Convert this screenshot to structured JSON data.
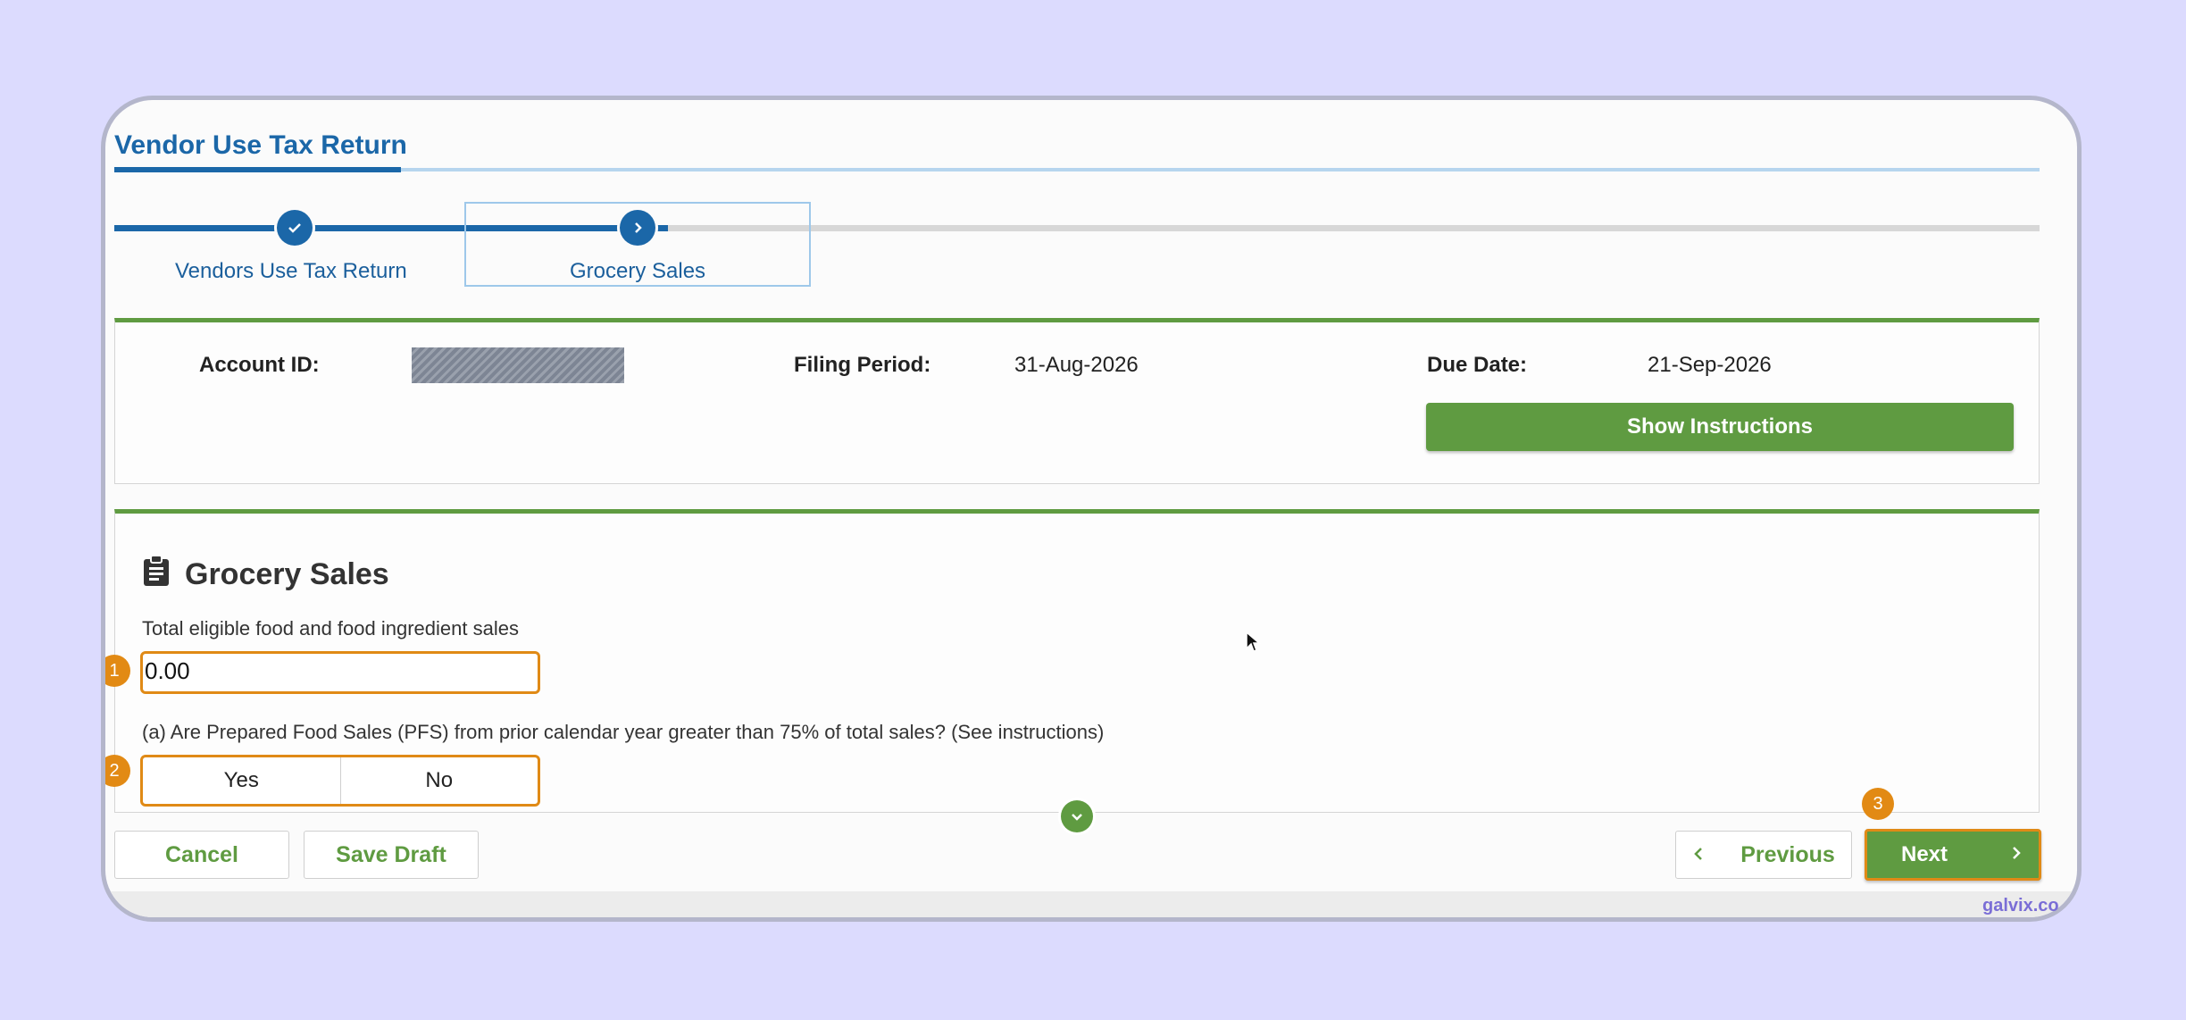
{
  "header": {
    "title": "Vendor Use Tax Return"
  },
  "stepper": {
    "steps": [
      {
        "label": "Vendors Use Tax Return",
        "state": "completed",
        "icon": "check-icon"
      },
      {
        "label": "Grocery Sales",
        "state": "current",
        "icon": "chevron-right-icon"
      }
    ]
  },
  "info": {
    "account_id_label": "Account ID:",
    "filing_period_label": "Filing Period:",
    "filing_period_value": "31-Aug-2026",
    "due_date_label": "Due Date:",
    "due_date_value": "21-Sep-2026",
    "show_instructions_label": "Show Instructions"
  },
  "form": {
    "section_title": "Grocery Sales",
    "section_icon": "clipboard-icon",
    "food_sales_label": "Total eligible food and food ingredient sales",
    "food_sales_value": "0.00",
    "pfs_question": "(a) Are Prepared Food Sales (PFS) from prior calendar year greater than 75% of total sales? (See instructions)",
    "yes_label": "Yes",
    "no_label": "No"
  },
  "annotations": {
    "badge1": "1",
    "badge2": "2",
    "badge3": "3"
  },
  "footer": {
    "cancel_label": "Cancel",
    "save_draft_label": "Save Draft",
    "previous_label": "Previous",
    "next_label": "Next"
  },
  "watermark": "galvix.co",
  "colors": {
    "primary_blue": "#1b67a8",
    "accent_green": "#5f9b41",
    "highlight_orange": "#e08a16",
    "background": "#dcdbfe"
  }
}
